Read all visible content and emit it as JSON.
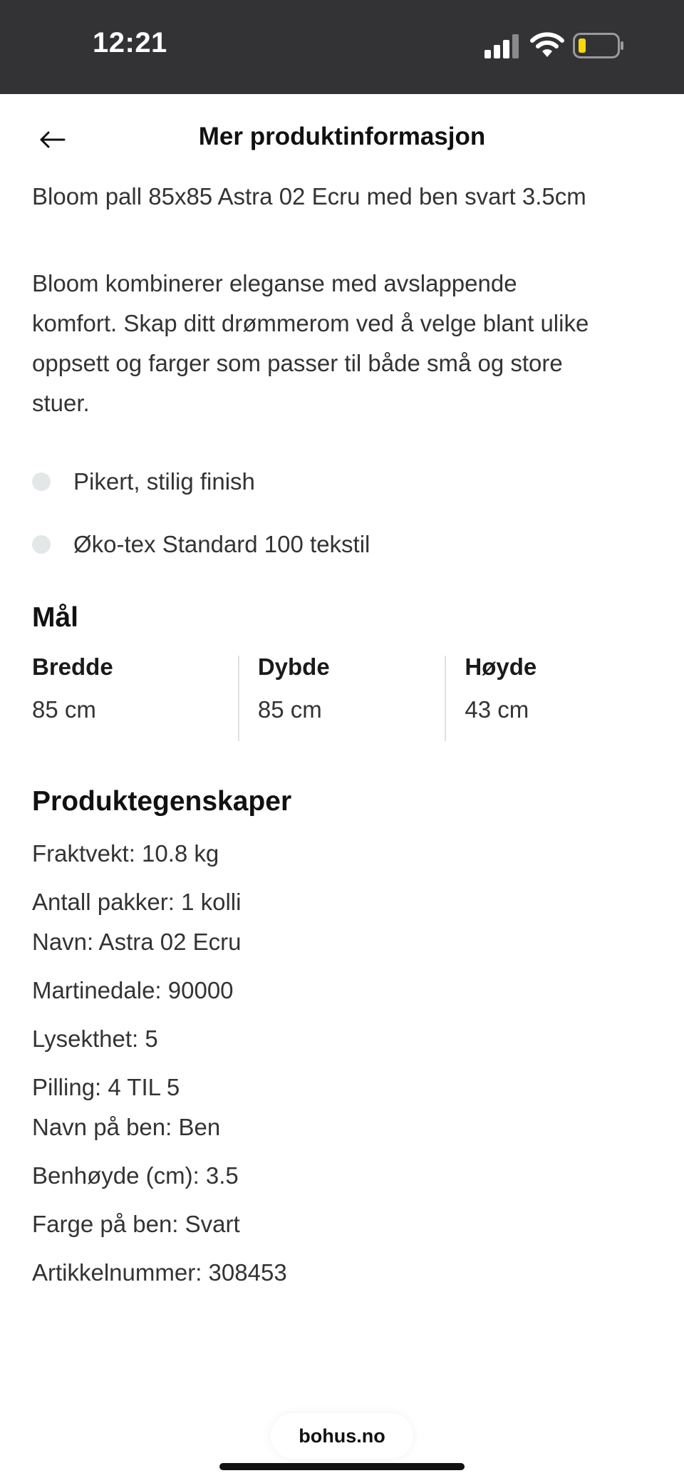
{
  "status_bar": {
    "time": "12:21"
  },
  "header": {
    "title": "Mer produktinformasjon"
  },
  "product": {
    "name": "Bloom pall 85x85 Astra 02 Ecru med ben svart 3.5cm",
    "description_lines": [
      "Bloom kombinerer eleganse med avslappende",
      "komfort. Skap ditt drømmerom ved å velge blant ulike",
      "oppsett og farger som passer til både små og store",
      "stuer."
    ],
    "features": [
      "Pikert, stilig finish",
      "Øko-tex Standard 100 tekstil"
    ]
  },
  "dimensions": {
    "title": "Mål",
    "items": [
      {
        "label": "Bredde",
        "value": "85 cm"
      },
      {
        "label": "Dybde",
        "value": "85 cm"
      },
      {
        "label": "Høyde",
        "value": "43 cm"
      }
    ]
  },
  "properties": {
    "title": "Produktegenskaper",
    "items": [
      "Fraktvekt: 10.8 kg",
      "Antall pakker: 1 kolli",
      "Navn: Astra 02 Ecru",
      "Martinedale: 90000",
      "Lysekthet: 5",
      "Pilling: 4 TIL 5",
      "Navn på ben: Ben",
      "Benhøyde (cm): 3.5",
      "Farge på ben: Svart",
      "Artikkelnummer: 308453"
    ]
  },
  "footer": {
    "domain": "bohus.no"
  },
  "colors": {
    "status_bar_bg": "#333335",
    "bullet": "#e3e7e8",
    "battery_fill": "#f5d90a"
  },
  "icons": [
    "signal-icon",
    "wifi-icon",
    "battery-icon",
    "arrow-left-icon"
  ]
}
